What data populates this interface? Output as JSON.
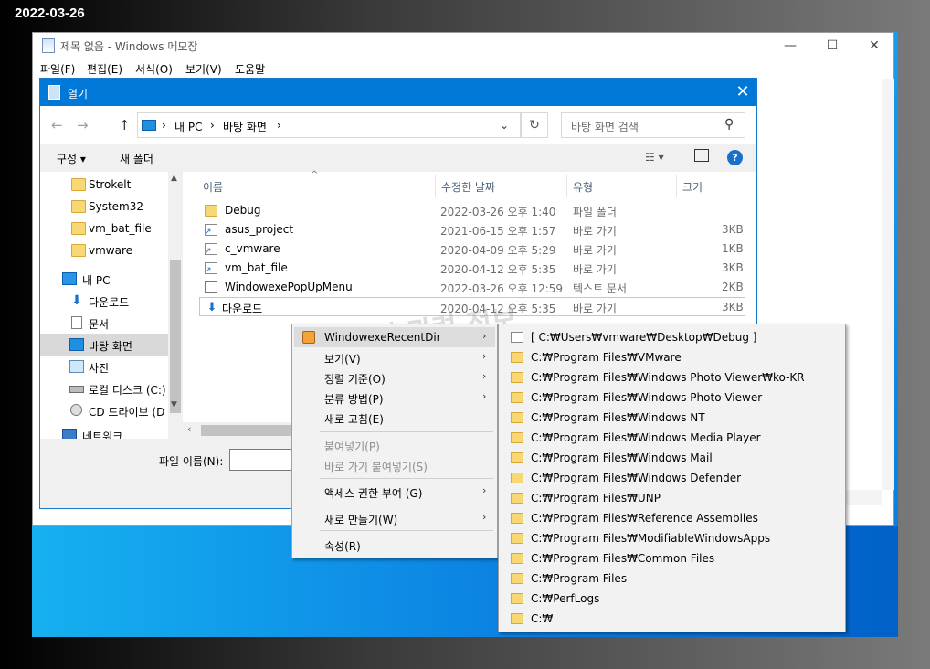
{
  "date_label": "2022-03-26",
  "notepad": {
    "title": "제목 없음 - Windows 메모장",
    "menu": [
      "파일(F)",
      "편집(E)",
      "서식(O)",
      "보기(V)",
      "도움말"
    ],
    "minimize": "—",
    "maximize": "☐",
    "close": "✕"
  },
  "dialog": {
    "title": "열기",
    "close": "✕",
    "nav": {
      "back": "←",
      "forward": "→",
      "up": "↑"
    },
    "breadcrumb": [
      "내 PC",
      "바탕 화면"
    ],
    "breadcrumb_sep": "›",
    "search_placeholder": "바탕 화면 검색",
    "toolbar": {
      "organize": "구성 ▾",
      "new_folder": "새 폴더",
      "help": "?"
    },
    "navpane": [
      {
        "label": "Strokelt",
        "icon": "folder-icon"
      },
      {
        "label": "System32",
        "icon": "folder-icon"
      },
      {
        "label": "vm_bat_file",
        "icon": "folder-icon"
      },
      {
        "label": "vmware",
        "icon": "folder-icon"
      },
      {
        "label": "내 PC",
        "icon": "pc-icon"
      },
      {
        "label": "다운로드",
        "icon": "download-icon"
      },
      {
        "label": "문서",
        "icon": "document-icon"
      },
      {
        "label": "바탕 화면",
        "icon": "desktop-icon"
      },
      {
        "label": "사진",
        "icon": "pictures-icon"
      },
      {
        "label": "로컬 디스크 (C:)",
        "icon": "disk-icon"
      },
      {
        "label": "CD 드라이브 (D",
        "icon": "cd-icon"
      },
      {
        "label": "네트워크",
        "icon": "network-icon"
      }
    ],
    "columns": {
      "name": "이름",
      "date": "수정한 날짜",
      "type": "유형",
      "size": "크기"
    },
    "files": [
      {
        "name": "Debug",
        "date": "2022-03-26 오후 1:40",
        "type": "파일 폴더",
        "size": "",
        "icon": "folder-icon"
      },
      {
        "name": "asus_project",
        "date": "2021-06-15 오후 1:57",
        "type": "바로 가기",
        "size": "3KB",
        "icon": "shortcut-icon"
      },
      {
        "name": "c_vmware",
        "date": "2020-04-09 오후 5:29",
        "type": "바로 가기",
        "size": "1KB",
        "icon": "shortcut-icon"
      },
      {
        "name": "vm_bat_file",
        "date": "2020-04-12 오후 5:35",
        "type": "바로 가기",
        "size": "3KB",
        "icon": "shortcut-icon"
      },
      {
        "name": "WindowexePopUpMenu",
        "date": "2022-03-26 오후 12:59",
        "type": "텍스트 문서",
        "size": "2KB",
        "icon": "text-file-icon"
      },
      {
        "name": "다운로드",
        "date": "2020-04-12 오후 5:35",
        "type": "바로 가기",
        "size": "3KB",
        "icon": "download-shortcut-icon"
      }
    ],
    "filename_label": "파일 이름(N):",
    "filename_value": ""
  },
  "context_menu": [
    {
      "label": "WindowexeRecentDir",
      "arrow": true,
      "icon": true,
      "highlight": true,
      "disabled": false
    },
    {
      "label": "보기(V)",
      "arrow": true
    },
    {
      "label": "정렬 기준(O)",
      "arrow": true
    },
    {
      "label": "분류 방법(P)",
      "arrow": true
    },
    {
      "label": "새로 고침(E)",
      "arrow": false
    },
    {
      "label": "붙여넣기(P)",
      "arrow": false,
      "disabled": true
    },
    {
      "label": "바로 가기 붙여넣기(S)",
      "arrow": false,
      "disabled": true
    },
    {
      "label": "액세스 권한 부여 (G)",
      "arrow": true
    },
    {
      "label": "새로 만들기(W)",
      "arrow": true
    },
    {
      "label": "속성(R)",
      "arrow": false
    }
  ],
  "submenu": [
    "[ C:₩Users₩vmware₩Desktop₩Debug ]",
    "C:₩Program Files₩VMware",
    "C:₩Program Files₩Windows Photo Viewer₩ko-KR",
    "C:₩Program Files₩Windows Photo Viewer",
    "C:₩Program Files₩Windows NT",
    "C:₩Program Files₩Windows Media Player",
    "C:₩Program Files₩Windows Mail",
    "C:₩Program Files₩Windows Defender",
    "C:₩Program Files₩UNP",
    "C:₩Program Files₩Reference Assemblies",
    "C:₩Program Files₩ModifiableWindowsApps",
    "C:₩Program Files₩Common Files",
    "C:₩Program Files",
    "C:₩PerfLogs",
    "C:₩"
  ],
  "watermark": "컴퓨터 관련 정보"
}
